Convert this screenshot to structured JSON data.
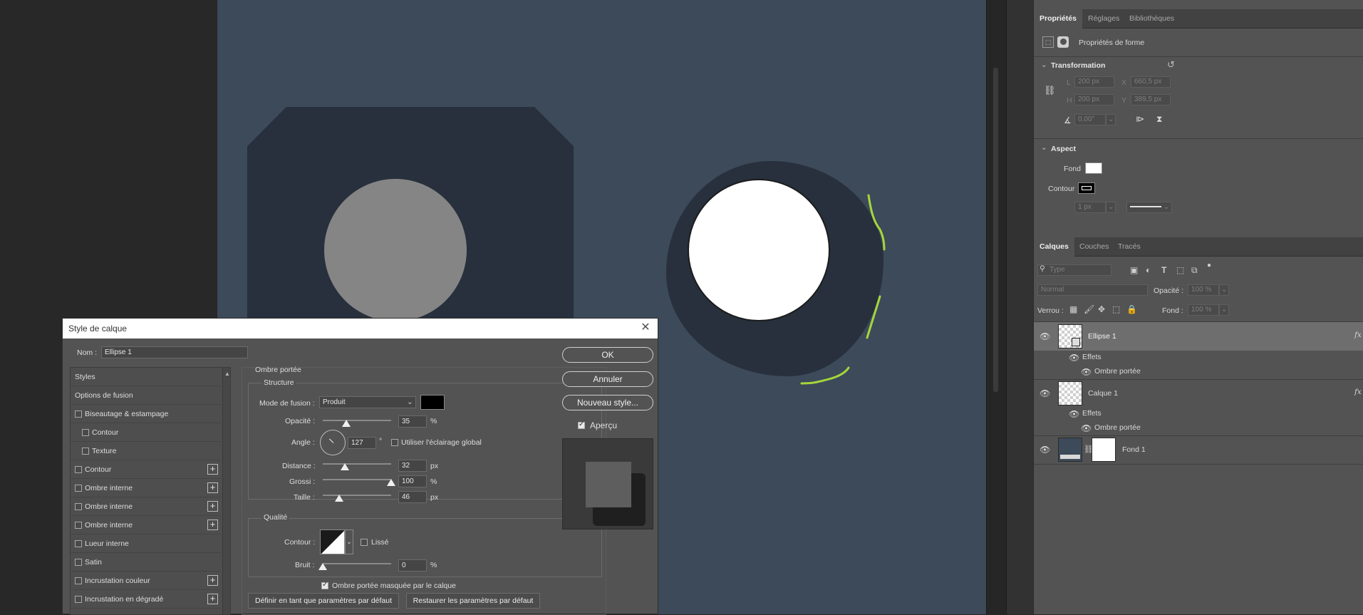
{
  "properties_panel": {
    "tabs": [
      {
        "label": "Propriétés",
        "active": true
      },
      {
        "label": "Réglages",
        "active": false
      },
      {
        "label": "Bibliothèques",
        "active": false
      }
    ],
    "shape_props_label": "Propriétés de forme",
    "transformation": {
      "title": "Transformation",
      "w_label": "L",
      "w_value": "200 px",
      "x_label": "X",
      "x_value": "660,5 px",
      "h_label": "H",
      "h_value": "200 px",
      "y_label": "Y",
      "y_value": "389,5 px",
      "angle_value": "0,00°"
    },
    "aspect": {
      "title": "Aspect",
      "fill_label": "Fond",
      "stroke_label": "Contour",
      "stroke_width": "1 px"
    }
  },
  "layers_panel": {
    "tabs": [
      {
        "label": "Calques",
        "active": true
      },
      {
        "label": "Couches",
        "active": false
      },
      {
        "label": "Tracés",
        "active": false
      }
    ],
    "filter_placeholder": "Type",
    "blend_mode": "Normal",
    "opacity_label": "Opacité :",
    "opacity_value": "100 %",
    "lock_label": "Verrou :",
    "fill_label": "Fond :",
    "fill_value": "100 %",
    "fx_badge": "fx",
    "layers": [
      {
        "name": "Ellipse 1",
        "effects_label": "Effets",
        "effect": "Ombre portée"
      },
      {
        "name": "Calque 1",
        "effects_label": "Effets",
        "effect": "Ombre portée"
      },
      {
        "name": "Fond 1"
      }
    ]
  },
  "dialog": {
    "title": "Style de calque",
    "name_label": "Nom :",
    "name_value": "Ellipse 1",
    "styles_header": "Styles",
    "blend_options": "Options de fusion",
    "style_items": [
      "Biseautage & estampage",
      "Contour",
      "Texture",
      "Contour",
      "Ombre interne",
      "Ombre interne",
      "Ombre interne",
      "Lueur interne",
      "Satin",
      "Incrustation couleur",
      "Incrustation en dégradé"
    ],
    "plus_symbol": "+",
    "section_title": "Ombre portée",
    "structure_title": "Structure",
    "blend_mode_label": "Mode de fusion :",
    "blend_mode_value": "Produit",
    "opacity_label": "Opacité :",
    "opacity_value": "35",
    "opacity_unit": "%",
    "angle_label": "Angle :",
    "angle_value": "127",
    "angle_unit": "°",
    "global_light_label": "Utiliser l'éclairage global",
    "distance_label": "Distance :",
    "distance_value": "32",
    "distance_unit": "px",
    "spread_label": "Grossi :",
    "spread_value": "100",
    "spread_unit": "%",
    "size_label": "Taille :",
    "size_value": "46",
    "size_unit": "px",
    "quality_title": "Qualité",
    "contour_label": "Contour :",
    "antialias_label": "Lissé",
    "noise_label": "Bruit :",
    "noise_value": "0",
    "noise_unit": "%",
    "knockout_label": "Ombre portée masquée par le calque",
    "set_default": "Définir en tant que paramètres par défaut",
    "reset_default": "Restaurer les paramètres par défaut",
    "ok": "OK",
    "cancel": "Annuler",
    "new_style": "Nouveau style...",
    "preview_label": "Aperçu"
  }
}
